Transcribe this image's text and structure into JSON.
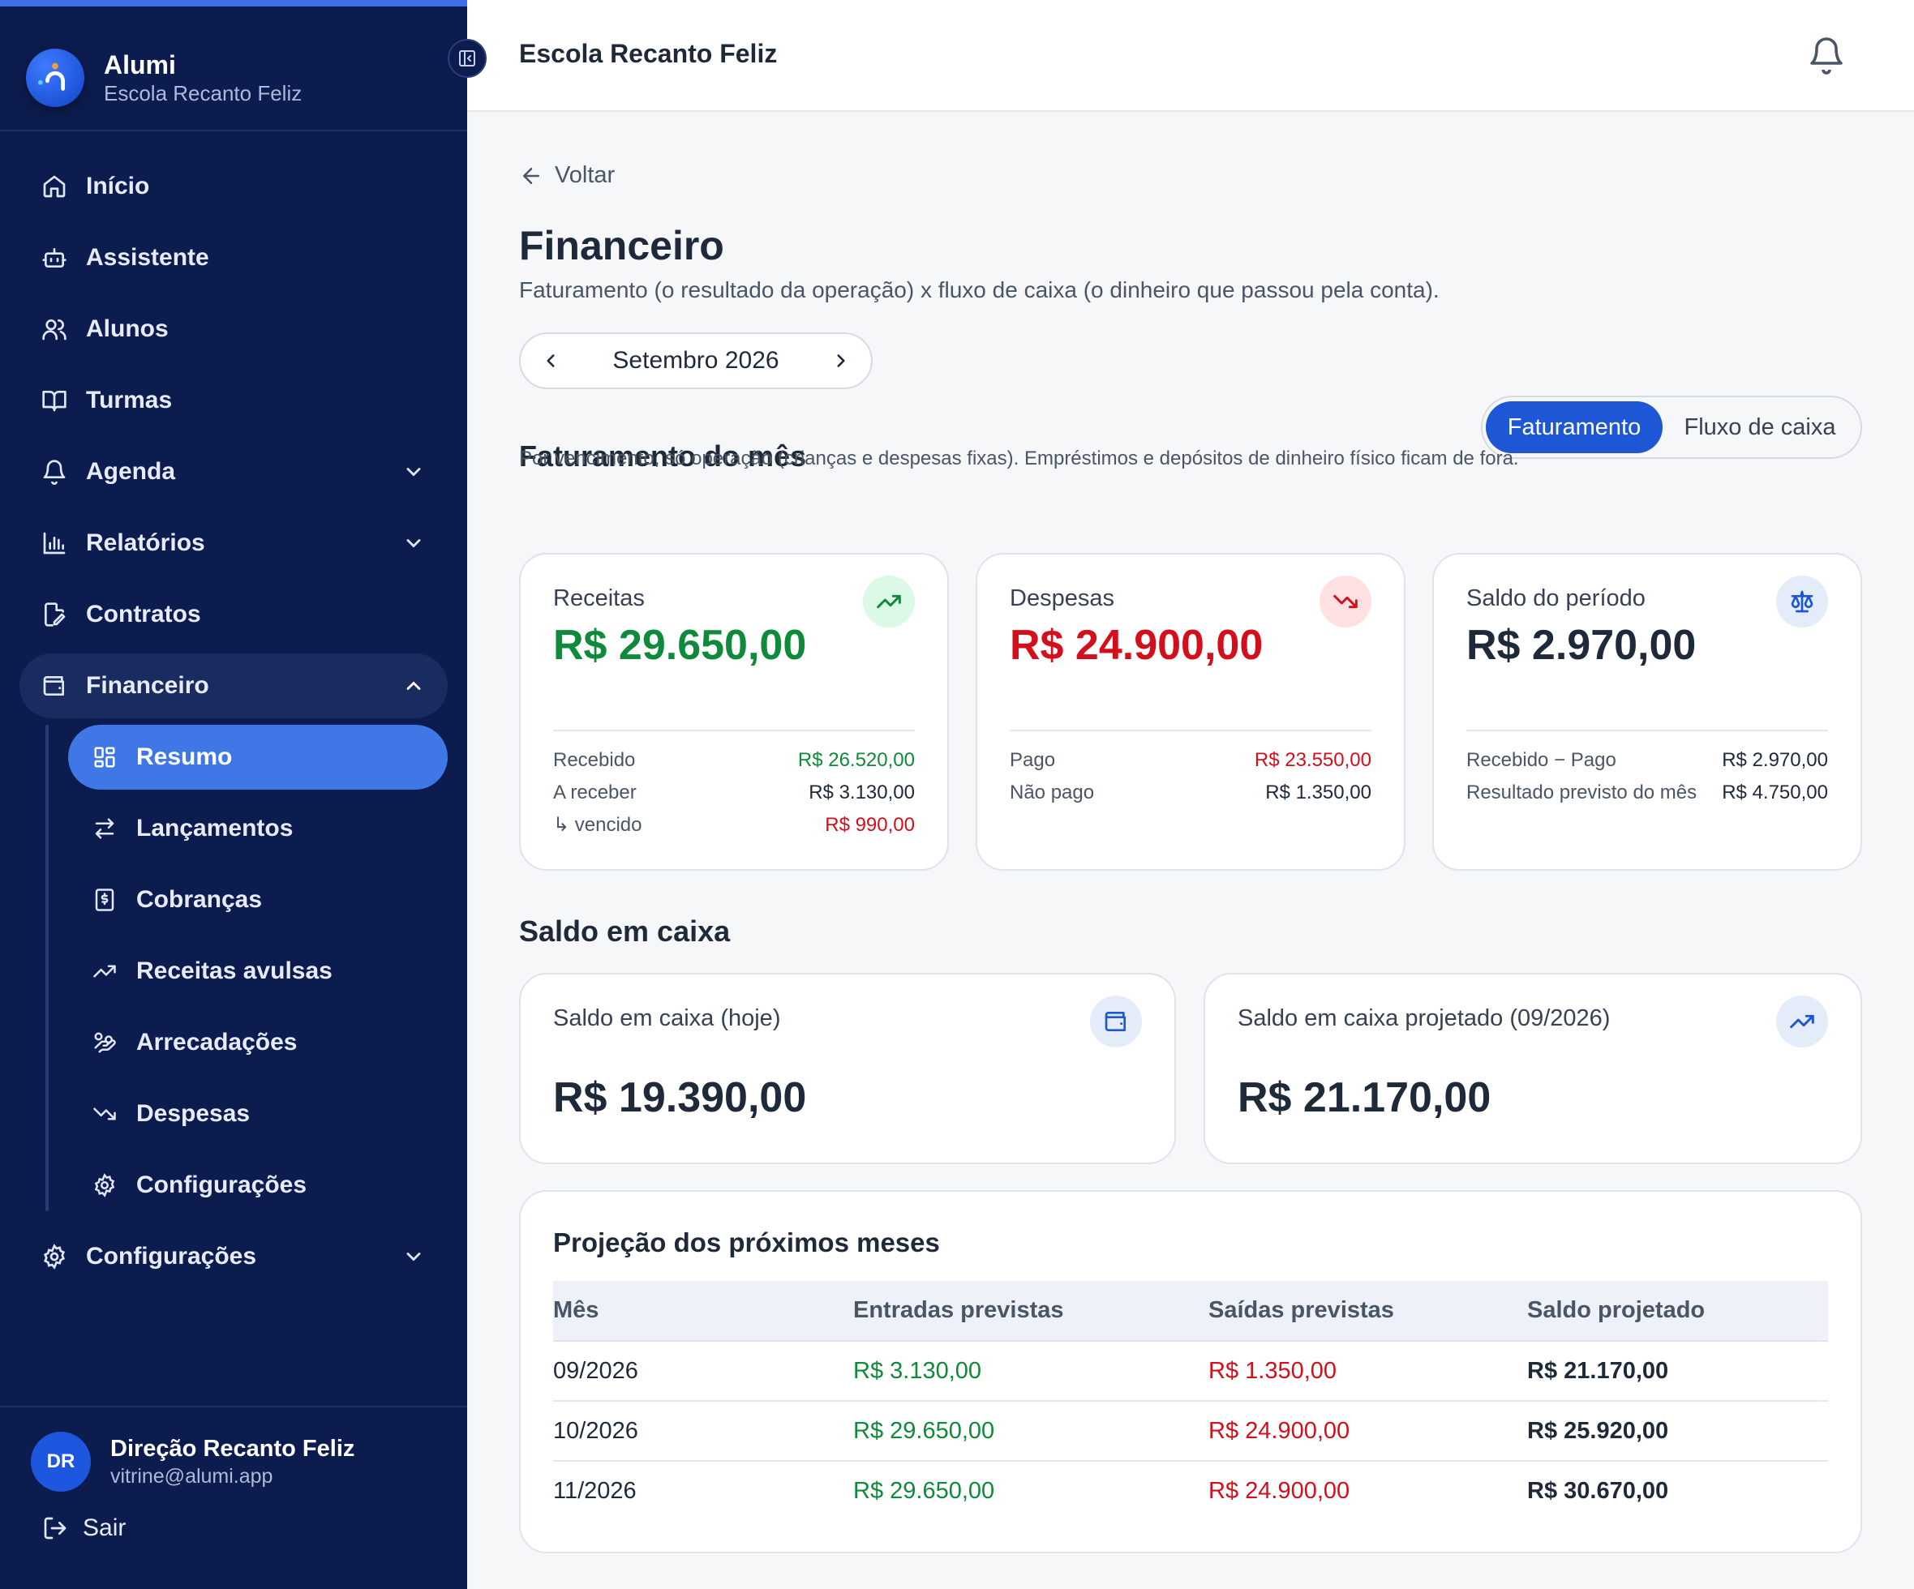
{
  "sidebar": {
    "brand_name": "Alumi",
    "brand_sub": "Escola Recanto Feliz",
    "items": [
      {
        "label": "Início"
      },
      {
        "label": "Assistente"
      },
      {
        "label": "Alunos"
      },
      {
        "label": "Turmas"
      },
      {
        "label": "Agenda"
      },
      {
        "label": "Relatórios"
      },
      {
        "label": "Contratos"
      },
      {
        "label": "Financeiro"
      },
      {
        "label": "Configurações"
      }
    ],
    "subitems": [
      {
        "label": "Resumo"
      },
      {
        "label": "Lançamentos"
      },
      {
        "label": "Cobranças"
      },
      {
        "label": "Receitas avulsas"
      },
      {
        "label": "Arrecadações"
      },
      {
        "label": "Despesas"
      },
      {
        "label": "Configurações"
      }
    ],
    "user": {
      "initials": "DR",
      "name": "Direção Recanto Feliz",
      "email": "vitrine@alumi.app"
    },
    "logout_label": "Sair"
  },
  "header": {
    "title": "Escola Recanto Feliz"
  },
  "main": {
    "back_label": "Voltar",
    "title": "Financeiro",
    "subtitle": "Faturamento (o resultado da operação) x fluxo de caixa (o dinheiro que passou pela conta).",
    "month": "Setembro 2026",
    "billing": {
      "title": "Faturamento do mês",
      "toggle": [
        "Faturamento",
        "Fluxo de caixa"
      ],
      "note": "Por vencimento, só operação (crianças e despesas fixas). Empréstimos e depósitos de dinheiro físico ficam de fora.",
      "cards": [
        {
          "label": "Receitas",
          "value": "R$ 29.650,00",
          "rows": [
            {
              "k": "Recebido",
              "v": "R$ 26.520,00"
            },
            {
              "k": "A receber",
              "v": "R$ 3.130,00"
            },
            {
              "k": "↳ vencido",
              "v": "R$ 990,00"
            }
          ]
        },
        {
          "label": "Despesas",
          "value": "R$ 24.900,00",
          "rows": [
            {
              "k": "Pago",
              "v": "R$ 23.550,00"
            },
            {
              "k": "Não pago",
              "v": "R$ 1.350,00"
            }
          ]
        },
        {
          "label": "Saldo do período",
          "value": "R$ 2.970,00",
          "rows": [
            {
              "k": "Recebido − Pago",
              "v": "R$ 2.970,00"
            },
            {
              "k": "Resultado previsto do mês",
              "v": "R$ 4.750,00"
            }
          ]
        }
      ]
    },
    "cash": {
      "title": "Saldo em caixa",
      "cards": [
        {
          "label": "Saldo em caixa (hoje)",
          "value": "R$ 19.390,00"
        },
        {
          "label": "Saldo em caixa projetado (09/2026)",
          "value": "R$ 21.170,00"
        }
      ]
    },
    "projection": {
      "title": "Projeção dos próximos meses",
      "columns": [
        "Mês",
        "Entradas previstas",
        "Saídas previstas",
        "Saldo projetado"
      ],
      "rows": [
        [
          "09/2026",
          "R$ 3.130,00",
          "R$ 1.350,00",
          "R$ 21.170,00"
        ],
        [
          "10/2026",
          "R$ 29.650,00",
          "R$ 24.900,00",
          "R$ 25.920,00"
        ],
        [
          "11/2026",
          "R$ 29.650,00",
          "R$ 24.900,00",
          "R$ 30.670,00"
        ]
      ]
    }
  },
  "colors": {
    "sidebar": "#0c1c4e",
    "accent": "#3f78e6",
    "primary": "#1d57d6",
    "positive": "#0e8a3a",
    "negative": "#d40f1c"
  }
}
